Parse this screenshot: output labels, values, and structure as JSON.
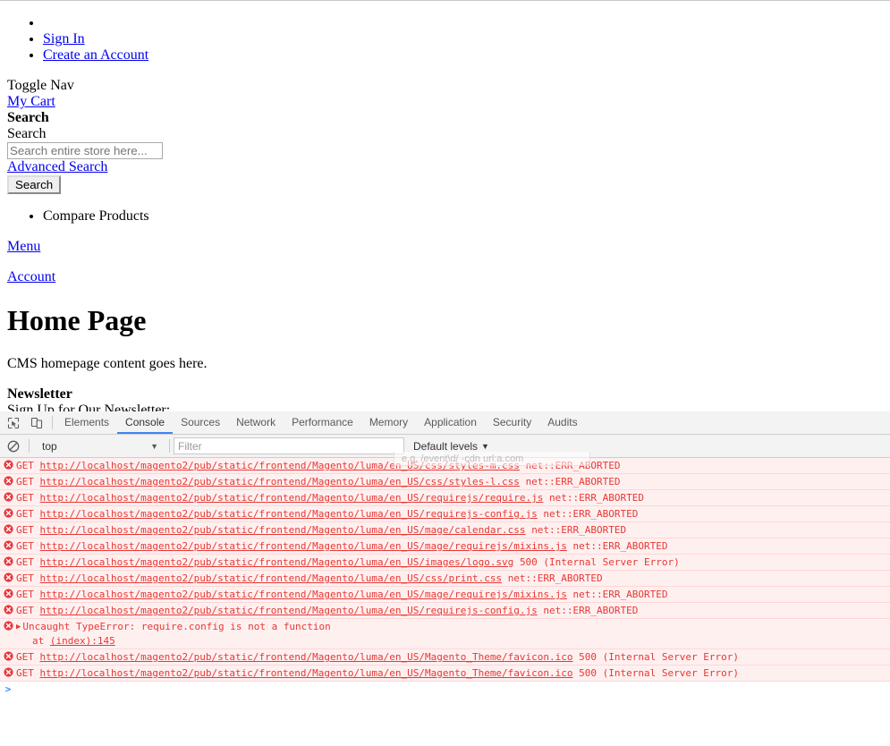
{
  "page": {
    "account_links": [
      "Sign In",
      "Create an Account"
    ],
    "toggle_nav": "Toggle Nav",
    "my_cart": "My Cart",
    "search_heading": "Search",
    "search_label": "Search",
    "search_placeholder": "Search entire store here...",
    "search_value": "",
    "advanced_search": "Advanced Search",
    "search_button": "Search",
    "compare_products": "Compare Products",
    "menu": "Menu",
    "account": "Account",
    "title": "Home Page",
    "cms_content": "CMS homepage content goes here.",
    "newsletter_heading": "Newsletter",
    "newsletter_subheading": "Sign Up for Our Newsletter:"
  },
  "devtools": {
    "inspect_icon": "inspect-element-icon",
    "device_icon": "device-toolbar-icon",
    "tabs": [
      {
        "label": "Elements",
        "active": false
      },
      {
        "label": "Console",
        "active": true
      },
      {
        "label": "Sources",
        "active": false
      },
      {
        "label": "Network",
        "active": false
      },
      {
        "label": "Performance",
        "active": false
      },
      {
        "label": "Memory",
        "active": false
      },
      {
        "label": "Application",
        "active": false
      },
      {
        "label": "Security",
        "active": false
      },
      {
        "label": "Audits",
        "active": false
      }
    ],
    "clear_icon": "clear-console-icon",
    "context": "top",
    "filter_placeholder": "Filter",
    "filter_value": "",
    "filter_hint": "e.g. /event\\d/ -cdn url:a.com",
    "levels": "Default levels",
    "prompt_caret": ">",
    "prompt_value": "",
    "base_url": "http://localhost/magento2/pub/static/frontend/Magento/luma/en_US/",
    "messages": [
      {
        "type": "network",
        "method": "GET",
        "url": "http://localhost/magento2/pub/static/frontend/Magento/luma/en_US/css/styles-m.css",
        "status": "net::ERR_ABORTED"
      },
      {
        "type": "network",
        "method": "GET",
        "url": "http://localhost/magento2/pub/static/frontend/Magento/luma/en_US/css/styles-l.css",
        "status": "net::ERR_ABORTED"
      },
      {
        "type": "network",
        "method": "GET",
        "url": "http://localhost/magento2/pub/static/frontend/Magento/luma/en_US/requirejs/require.js",
        "status": "net::ERR_ABORTED"
      },
      {
        "type": "network",
        "method": "GET",
        "url": "http://localhost/magento2/pub/static/frontend/Magento/luma/en_US/requirejs-config.js",
        "status": "net::ERR_ABORTED"
      },
      {
        "type": "network",
        "method": "GET",
        "url": "http://localhost/magento2/pub/static/frontend/Magento/luma/en_US/mage/calendar.css",
        "status": "net::ERR_ABORTED"
      },
      {
        "type": "network",
        "method": "GET",
        "url": "http://localhost/magento2/pub/static/frontend/Magento/luma/en_US/mage/requirejs/mixins.js",
        "status": "net::ERR_ABORTED"
      },
      {
        "type": "network",
        "method": "GET",
        "url": "http://localhost/magento2/pub/static/frontend/Magento/luma/en_US/images/logo.svg",
        "status": "500 (Internal Server Error)"
      },
      {
        "type": "network",
        "method": "GET",
        "url": "http://localhost/magento2/pub/static/frontend/Magento/luma/en_US/css/print.css",
        "status": "net::ERR_ABORTED"
      },
      {
        "type": "network",
        "method": "GET",
        "url": "http://localhost/magento2/pub/static/frontend/Magento/luma/en_US/mage/requirejs/mixins.js",
        "status": "net::ERR_ABORTED"
      },
      {
        "type": "network",
        "method": "GET",
        "url": "http://localhost/magento2/pub/static/frontend/Magento/luma/en_US/requirejs-config.js",
        "status": "net::ERR_ABORTED"
      },
      {
        "type": "exception",
        "text": "Uncaught TypeError: require.config is not a function",
        "stack_prefix": "at ",
        "stack_link": "(index):145"
      },
      {
        "type": "network",
        "method": "GET",
        "url": "http://localhost/magento2/pub/static/frontend/Magento/luma/en_US/Magento_Theme/favicon.ico",
        "status": "500 (Internal Server Error)"
      },
      {
        "type": "network",
        "method": "GET",
        "url": "http://localhost/magento2/pub/static/frontend/Magento/luma/en_US/Magento_Theme/favicon.ico",
        "status": "500 (Internal Server Error)"
      }
    ]
  }
}
